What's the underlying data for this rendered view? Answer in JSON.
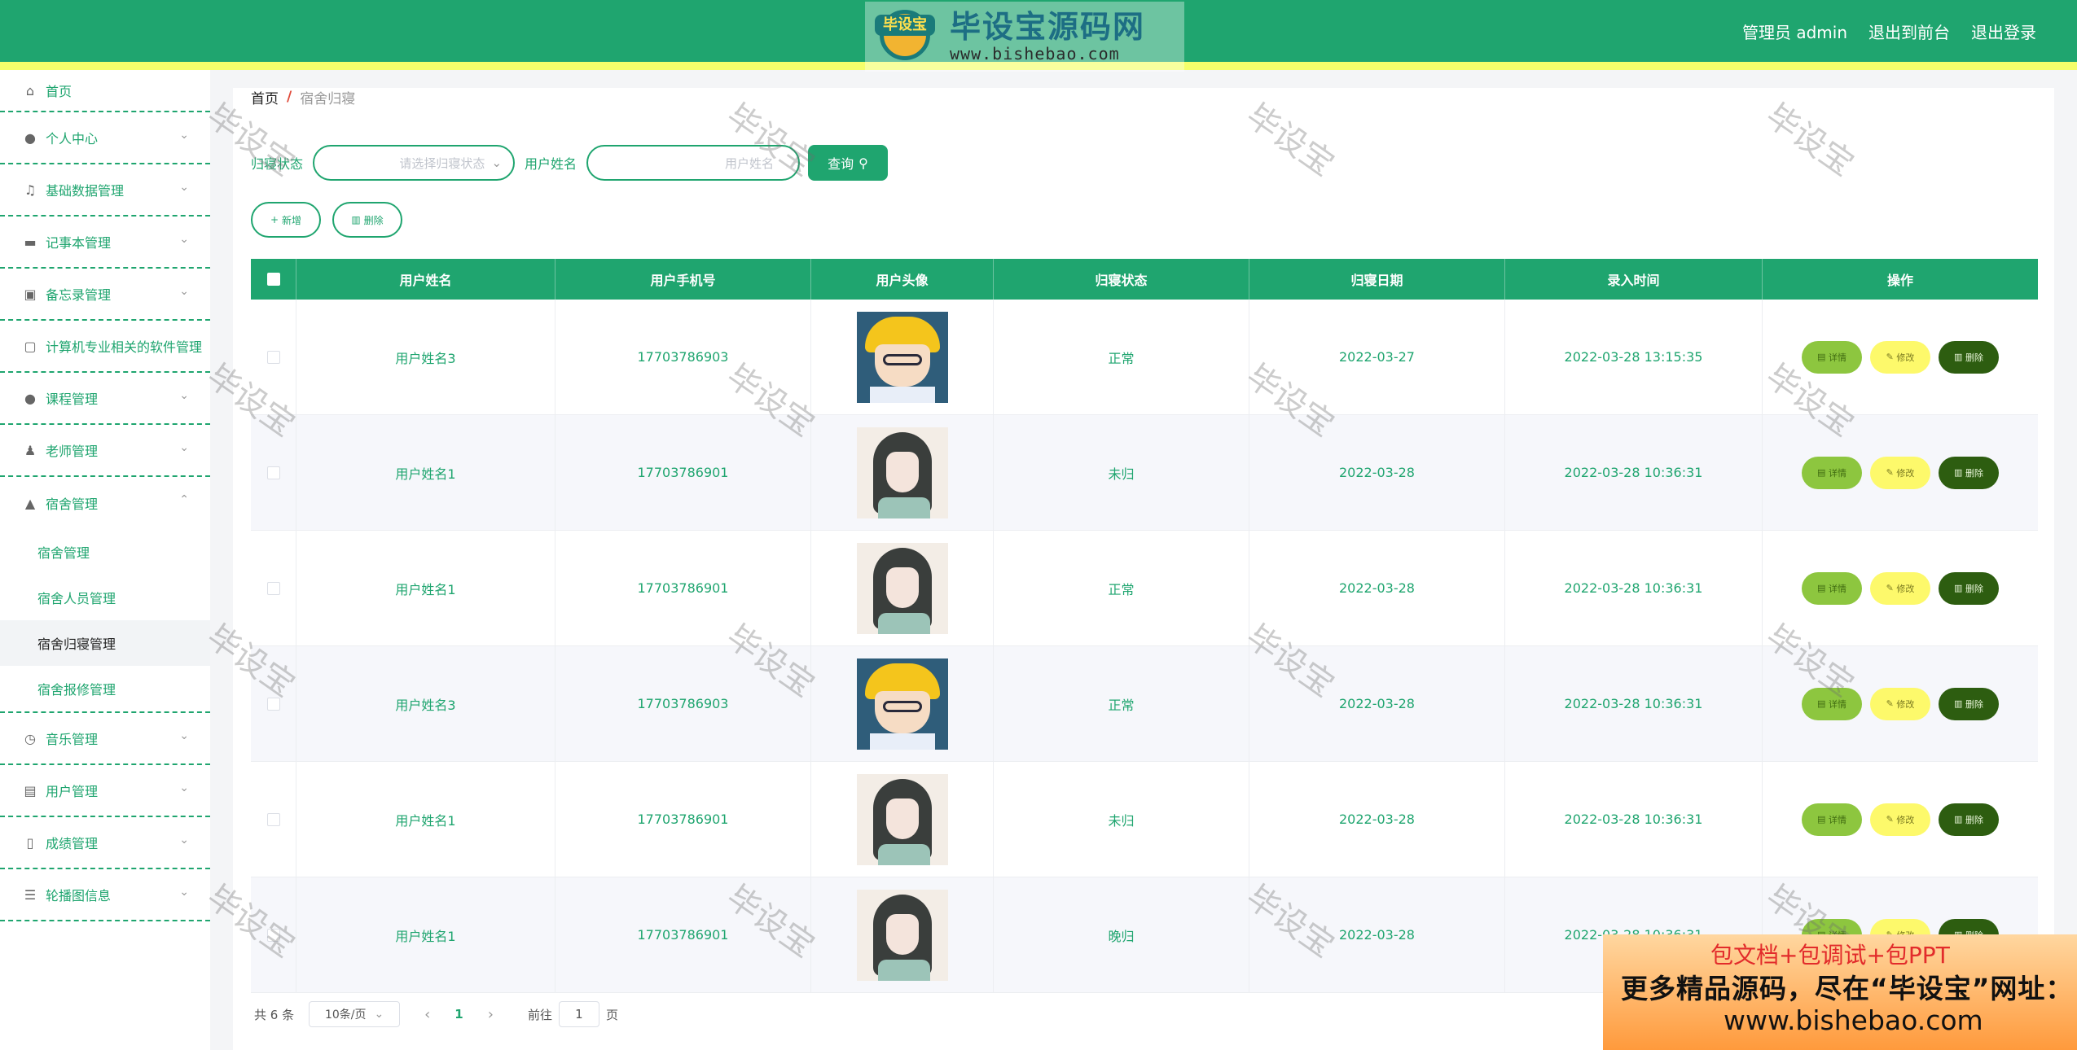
{
  "header": {
    "admin_label": "管理员 admin",
    "front_label": "退出到前台",
    "logout_label": "退出登录",
    "logo_badge": "毕设宝",
    "logo_title": "毕设宝源码网",
    "logo_url": "www.bishebao.com",
    "color": "#1fa56f"
  },
  "sidebar": {
    "home": "首页",
    "items": [
      {
        "label": "个人中心",
        "icon": "user-icon"
      },
      {
        "label": "基础数据管理",
        "icon": "bell-off-icon"
      },
      {
        "label": "记事本管理",
        "icon": "monitor-icon"
      },
      {
        "label": "备忘录管理",
        "icon": "chart-icon"
      },
      {
        "label": "计算机专业相关的软件管理",
        "icon": "chat-icon"
      },
      {
        "label": "课程管理",
        "icon": "user-icon"
      },
      {
        "label": "老师管理",
        "icon": "stamp-icon"
      },
      {
        "label": "宿舍管理",
        "icon": "thumb-icon"
      },
      {
        "label": "音乐管理",
        "icon": "clock-icon"
      },
      {
        "label": "用户管理",
        "icon": "clipboard-icon"
      },
      {
        "label": "成绩管理",
        "icon": "phone-icon"
      },
      {
        "label": "轮播图信息",
        "icon": "sliders-icon"
      }
    ],
    "sub_items": [
      "宿舍管理",
      "宿舍人员管理",
      "宿舍归寝管理",
      "宿舍报修管理"
    ]
  },
  "breadcrumb": {
    "home": "首页",
    "sep": "/",
    "current": "宿舍归寝"
  },
  "search": {
    "status_label": "归寝状态",
    "status_placeholder": "请选择归寝状态",
    "name_label": "用户姓名",
    "name_placeholder": "用户姓名",
    "query_label": "查询"
  },
  "actions": {
    "add_label": "新增",
    "delete_label": "删除"
  },
  "table": {
    "headers": [
      "用户姓名",
      "用户手机号",
      "用户头像",
      "归寝状态",
      "归寝日期",
      "录入时间",
      "操作"
    ],
    "rows": [
      {
        "name": "用户姓名3",
        "phone": "17703786903",
        "avatar": "boy-avatar",
        "status": "正常",
        "date": "2022-03-27",
        "created": "2022-03-28 13:15:35"
      },
      {
        "name": "用户姓名1",
        "phone": "17703786901",
        "avatar": "girl-avatar",
        "status": "未归",
        "date": "2022-03-28",
        "created": "2022-03-28 10:36:31"
      },
      {
        "name": "用户姓名1",
        "phone": "17703786901",
        "avatar": "girl-avatar",
        "status": "正常",
        "date": "2022-03-28",
        "created": "2022-03-28 10:36:31"
      },
      {
        "name": "用户姓名3",
        "phone": "17703786903",
        "avatar": "boy-avatar",
        "status": "正常",
        "date": "2022-03-28",
        "created": "2022-03-28 10:36:31"
      },
      {
        "name": "用户姓名1",
        "phone": "17703786901",
        "avatar": "girl-avatar",
        "status": "未归",
        "date": "2022-03-28",
        "created": "2022-03-28 10:36:31"
      },
      {
        "name": "用户姓名1",
        "phone": "17703786901",
        "avatar": "girl-avatar",
        "status": "晚归",
        "date": "2022-03-28",
        "created": "2022-03-28 10:36:31"
      }
    ],
    "op_detail": "详情",
    "op_edit": "修改",
    "op_delete": "删除"
  },
  "pager": {
    "total": "共 6 条",
    "size": "10条/页",
    "current": "1",
    "goto_prefix": "前往",
    "goto_value": "1",
    "goto_suffix": "页"
  },
  "watermark": "毕设宝",
  "promo": {
    "line1": "包文档+包调试+包PPT",
    "line2": "更多精品源码，尽在“毕设宝”网址：",
    "line3": "www.bishebao.com"
  }
}
